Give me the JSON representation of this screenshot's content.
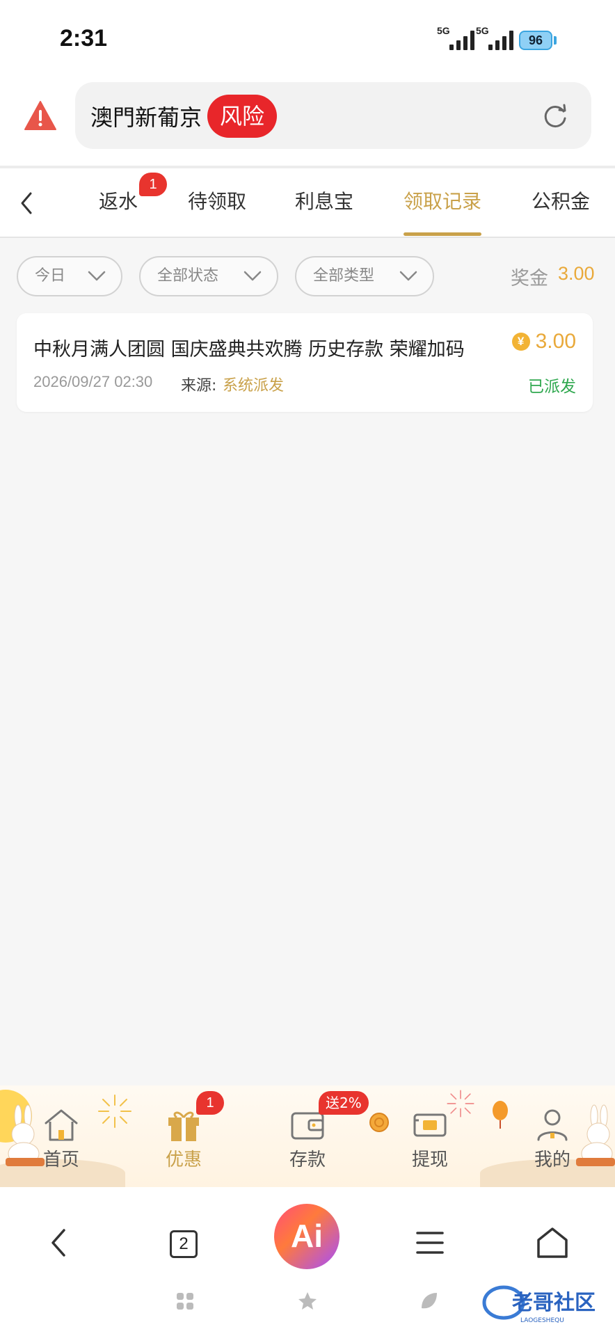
{
  "status_bar": {
    "time": "2:31",
    "network_1": "5G",
    "network_2": "5G",
    "battery": "96"
  },
  "browser": {
    "url_text": "澳門新葡京",
    "risk_badge": "风险",
    "warning_icon": "warning-triangle-icon",
    "reload_icon": "reload-icon"
  },
  "tabs": {
    "items": [
      {
        "label": "返水",
        "badge": "1"
      },
      {
        "label": "待领取"
      },
      {
        "label": "利息宝"
      },
      {
        "label": "领取记录",
        "active": true
      },
      {
        "label": "公积金"
      }
    ]
  },
  "filters": {
    "date": "今日",
    "status": "全部状态",
    "type": "全部类型",
    "bonus_label": "奖金",
    "bonus_value": "3.00"
  },
  "records": [
    {
      "title": "中秋月满人团圆 国庆盛典共欢腾 历史存款 荣耀加码",
      "amount": "3.00",
      "time": "2026/09/27 02:30",
      "source_label": "来源:",
      "source": "系统派发",
      "status": "已派发"
    }
  ],
  "site_nav": {
    "items": [
      {
        "label": "首页",
        "icon": "home-icon"
      },
      {
        "label": "优惠",
        "icon": "gift-icon",
        "badge": "1",
        "active": true
      },
      {
        "label": "存款",
        "icon": "wallet-icon",
        "promo": "送2%"
      },
      {
        "label": "提现",
        "icon": "cash-icon"
      },
      {
        "label": "我的",
        "icon": "user-icon"
      }
    ]
  },
  "toolbar": {
    "tab_count": "2",
    "ai_label": "Ai"
  },
  "watermark": {
    "text": "老哥社区",
    "subtext": "LAOGESHEQU"
  },
  "colors": {
    "accent_gold": "#c9a14a",
    "amount_orange": "#e9a93a",
    "risk_red": "#e8262a",
    "status_green": "#2fa84f"
  }
}
